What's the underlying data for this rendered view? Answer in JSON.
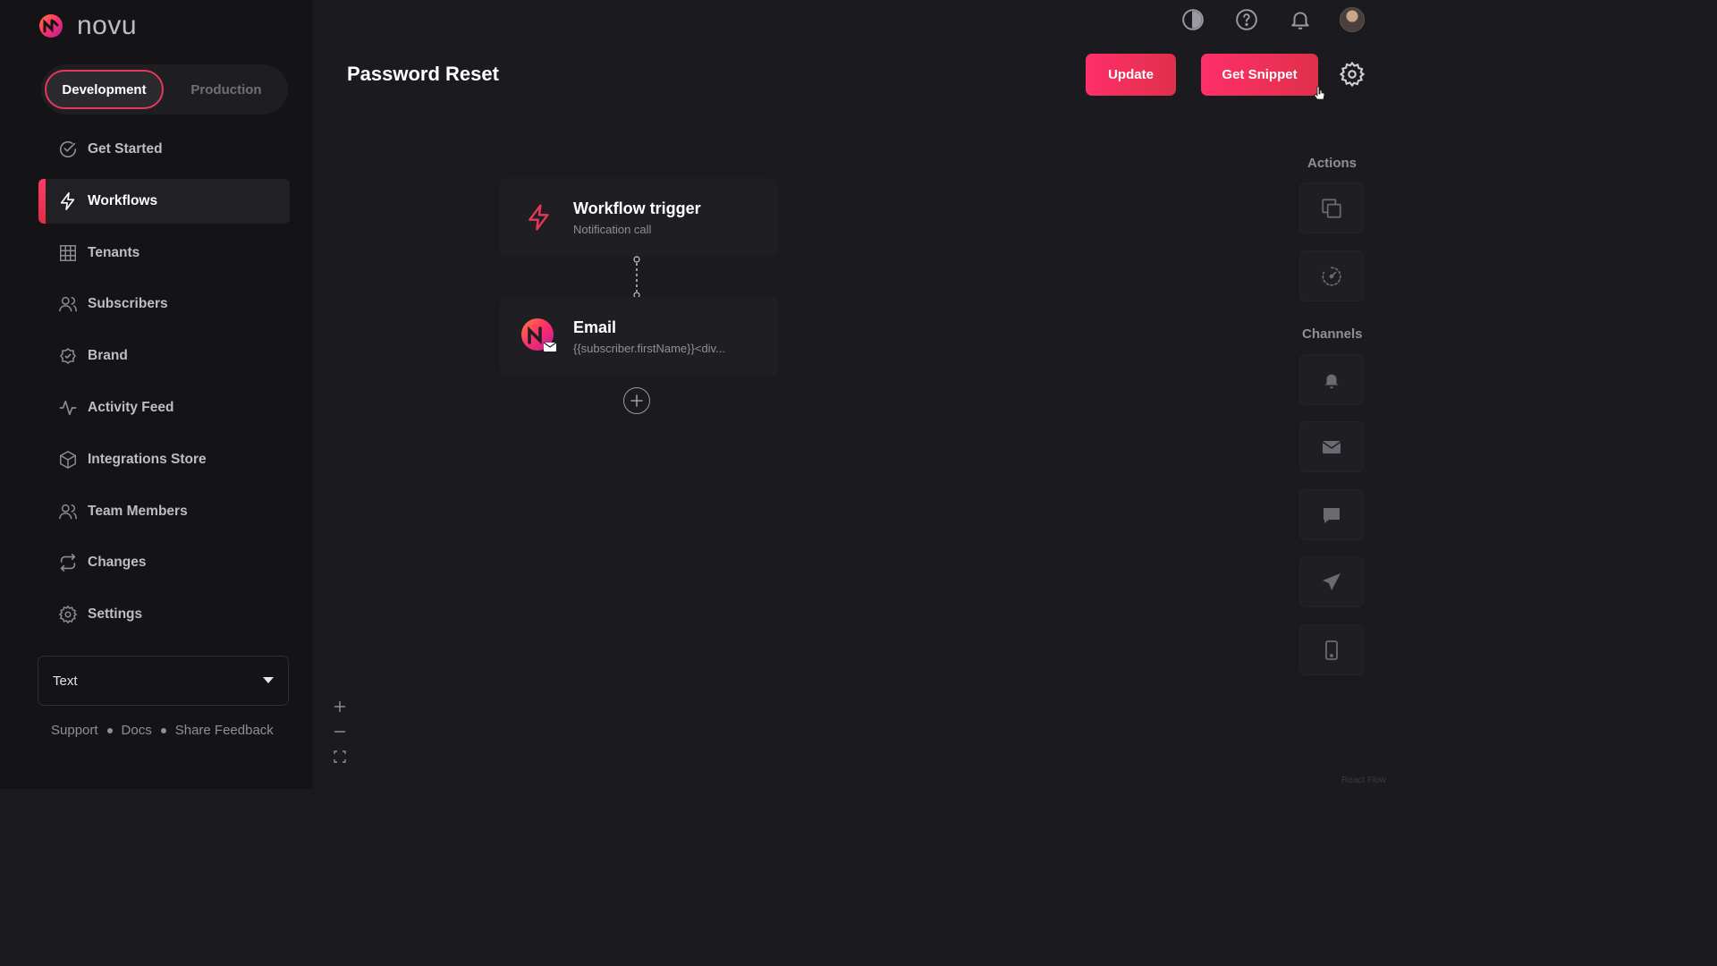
{
  "brand": {
    "name": "novu"
  },
  "env": {
    "development": "Development",
    "production": "Production"
  },
  "sidebar": {
    "items": [
      {
        "label": "Get Started",
        "icon": "check-circle-icon"
      },
      {
        "label": "Workflows",
        "icon": "bolt-icon",
        "active": true
      },
      {
        "label": "Tenants",
        "icon": "building-icon"
      },
      {
        "label": "Subscribers",
        "icon": "users-icon"
      },
      {
        "label": "Brand",
        "icon": "badge-check-icon"
      },
      {
        "label": "Activity Feed",
        "icon": "activity-icon"
      },
      {
        "label": "Integrations Store",
        "icon": "box-icon"
      },
      {
        "label": "Team Members",
        "icon": "team-icon"
      },
      {
        "label": "Changes",
        "icon": "repeat-icon"
      },
      {
        "label": "Settings",
        "icon": "gear-icon"
      }
    ],
    "select_value": "Text",
    "footer": {
      "support": "Support",
      "docs": "Docs",
      "feedback": "Share Feedback"
    }
  },
  "page": {
    "title": "Password Reset",
    "update_label": "Update",
    "snippet_label": "Get Snippet"
  },
  "nodes": {
    "trigger": {
      "title": "Workflow trigger",
      "subtitle": "Notification call"
    },
    "email": {
      "title": "Email",
      "subtitle": "{{subscriber.firstName}}<div..."
    }
  },
  "panel": {
    "actions_title": "Actions",
    "channels_title": "Channels"
  },
  "watermark": "React Flow",
  "colors": {
    "accent": "#e8385a",
    "background": "#1b1b1f",
    "sidebar": "#141417"
  }
}
